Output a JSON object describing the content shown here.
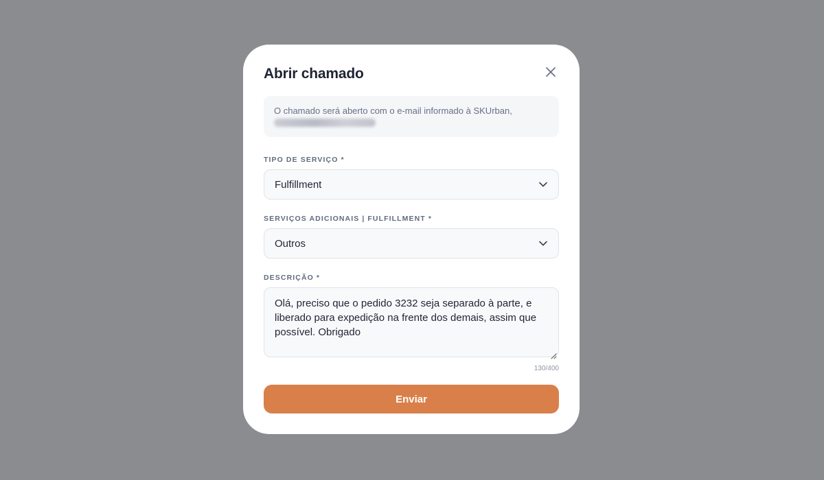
{
  "modal": {
    "title": "Abrir chamado",
    "close_icon": "close-icon",
    "info": {
      "text": "O chamado será aberto com o e-mail informado à SKUrban,"
    },
    "tipo_servico": {
      "label": "TIPO DE SERVIÇO *",
      "value": "Fulfillment",
      "icon": "chevron-down-icon"
    },
    "servicos_adicionais": {
      "label": "SERVIÇOS ADICIONAIS | FULFILLMENT *",
      "value": "Outros",
      "icon": "chevron-down-icon"
    },
    "descricao": {
      "label": "DESCRIÇÃO *",
      "value": "Olá, preciso que o pedido 3232 seja separado à parte, e liberado para expedição na frente dos demais, assim que possível. Obrigado",
      "counter": "130/400"
    },
    "submit_label": "Enviar"
  },
  "colors": {
    "overlay": "#8b8c8f",
    "accent": "#d9804a",
    "title": "#1f2433",
    "label": "#5f6b7d"
  }
}
